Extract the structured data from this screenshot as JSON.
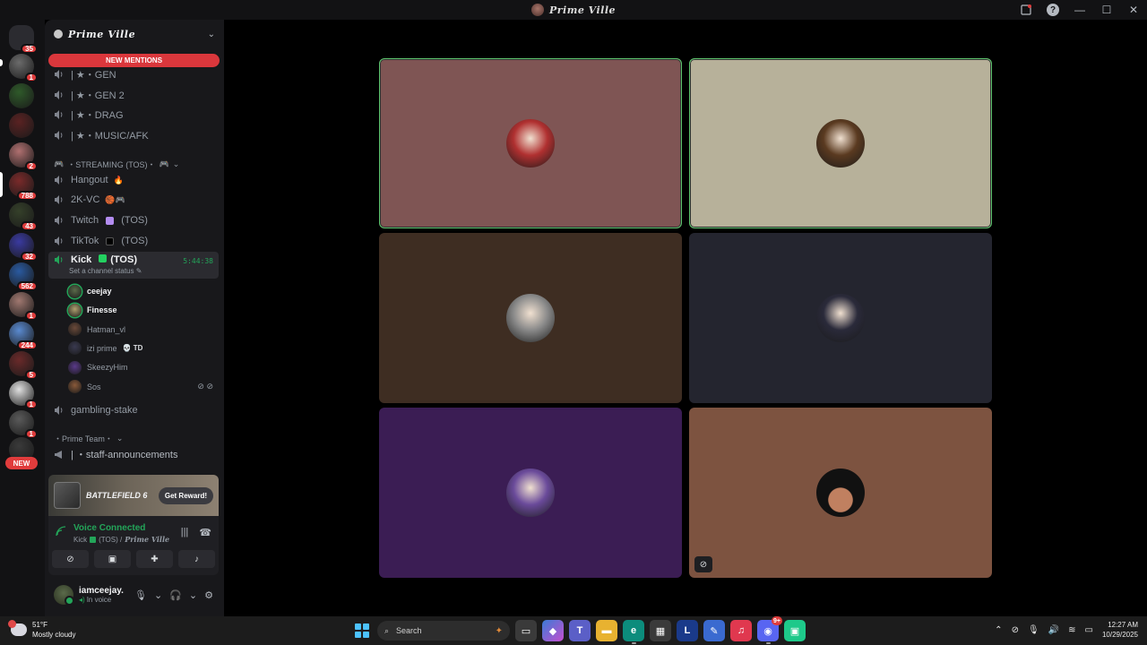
{
  "window": {
    "title": "Prime Ville",
    "controls": {
      "minimize": "—",
      "maximize": "☐",
      "close": "✕",
      "help": "?"
    }
  },
  "rail": {
    "servers": [
      {
        "name": "discord-home",
        "color": "#ffffff",
        "badge": "35"
      },
      {
        "name": "server-2",
        "color": "#6b6b6b",
        "badge": "1"
      },
      {
        "name": "server-3",
        "color": "#2f5a2a",
        "badge": ""
      },
      {
        "name": "server-4",
        "color": "#5a2222",
        "badge": ""
      },
      {
        "name": "server-5",
        "color": "#b07070",
        "badge": "2"
      },
      {
        "name": "prime-ville",
        "color": "#7a2a2a",
        "badge": "788"
      },
      {
        "name": "server-7",
        "color": "#35402a",
        "badge": "43"
      },
      {
        "name": "server-8",
        "color": "#3a3aa0",
        "badge": "32"
      },
      {
        "name": "server-9",
        "color": "#2a5aa0",
        "badge": "562"
      },
      {
        "name": "server-10",
        "color": "#a07870",
        "badge": "1"
      },
      {
        "name": "server-11",
        "color": "#5a8ad0",
        "badge": "244"
      },
      {
        "name": "server-12",
        "color": "#6a2a2a",
        "badge": "5"
      },
      {
        "name": "server-13",
        "color": "#e0e0e0",
        "badge": "1"
      },
      {
        "name": "server-14",
        "color": "#5a5a5a",
        "badge": "1"
      },
      {
        "name": "server-15",
        "color": "#3a3a3a",
        "badge": ""
      }
    ],
    "new_label": "NEW"
  },
  "sidebar": {
    "guild_name": "Prime Ville",
    "new_mentions": "NEW MENTIONS",
    "channels": [
      {
        "label": "| ★・GEN"
      },
      {
        "label": "| ★・GEN 2"
      },
      {
        "label": "| ★・DRAG"
      },
      {
        "label": "| ★・MUSIC/AFK"
      }
    ],
    "category_streaming": "・STREAMING (TOS)・",
    "hangout": {
      "label": "Hangout",
      "emoji": "🔥"
    },
    "vc2k": {
      "label": "2K-VC",
      "emoji": "🏀🎮"
    },
    "twitch": {
      "label": "Twitch",
      "suffix": "(TOS)",
      "color": "#b38cf0"
    },
    "tiktok": {
      "label": "TikTok",
      "suffix": "(TOS)",
      "color": "#000000"
    },
    "kick": {
      "label": "Kick",
      "suffix": "(TOS)",
      "color": "#23d160",
      "timer": "5:44:38",
      "status_placeholder": "Set a channel status ✎"
    },
    "voice_users": [
      {
        "name": "ceejay",
        "bright": true,
        "speaking": true,
        "color": "#5a6a4a",
        "tag": "",
        "icons": ""
      },
      {
        "name": "Finesse",
        "bright": true,
        "speaking": true,
        "color": "#b0a070",
        "tag": "",
        "icons": ""
      },
      {
        "name": "Hatman_vl",
        "bright": false,
        "speaking": false,
        "color": "#6a4a3a",
        "tag": "",
        "icons": ""
      },
      {
        "name": "izi prime",
        "bright": false,
        "speaking": false,
        "color": "#3a3a50",
        "tag": "💀 TD",
        "icons": ""
      },
      {
        "name": "SkeezyHim",
        "bright": false,
        "speaking": false,
        "color": "#5a3a8a",
        "tag": "",
        "icons": ""
      },
      {
        "name": "Sos",
        "bright": false,
        "speaking": false,
        "color": "#8a5a3a",
        "tag": "",
        "icons": "⊘ ⊘"
      }
    ],
    "gambling": "gambling-stake",
    "category_team": "・Prime Team・",
    "staff": "| ・staff-announcements"
  },
  "promo": {
    "title": "BATTLEFIELD 6",
    "button": "Get Reward!"
  },
  "voice_panel": {
    "status": "Voice Connected",
    "channel": "Kick",
    "suffix": "(TOS) /",
    "server": "Prime Ville"
  },
  "user": {
    "name": "iamceejay.",
    "status": "In voice"
  },
  "tiles": [
    {
      "name": "tile-ceejay",
      "bg": "#7f5554",
      "avatar": "#b03030",
      "speaking": true
    },
    {
      "name": "tile-finesse",
      "bg": "#b7b19a",
      "avatar": "#5a3a20",
      "speaking": true
    },
    {
      "name": "tile-hatman",
      "bg": "#3e2d22",
      "avatar": "#8a8a8a",
      "speaking": false
    },
    {
      "name": "tile-izi-prime",
      "bg": "#24252f",
      "avatar": "#2a2a3a",
      "speaking": false
    },
    {
      "name": "tile-skeezyhim",
      "bg": "#3b1d54",
      "avatar": "#6a4a9a",
      "speaking": false
    },
    {
      "name": "tile-sos",
      "bg": "#7d5340",
      "avatar": "#1a1010",
      "speaking": false
    }
  ],
  "taskbar": {
    "weather_temp": "51°F",
    "weather_desc": "Mostly cloudy",
    "search_placeholder": "Search",
    "time": "12:27 AM",
    "date": "10/29/2025",
    "discord_count": "9+"
  }
}
